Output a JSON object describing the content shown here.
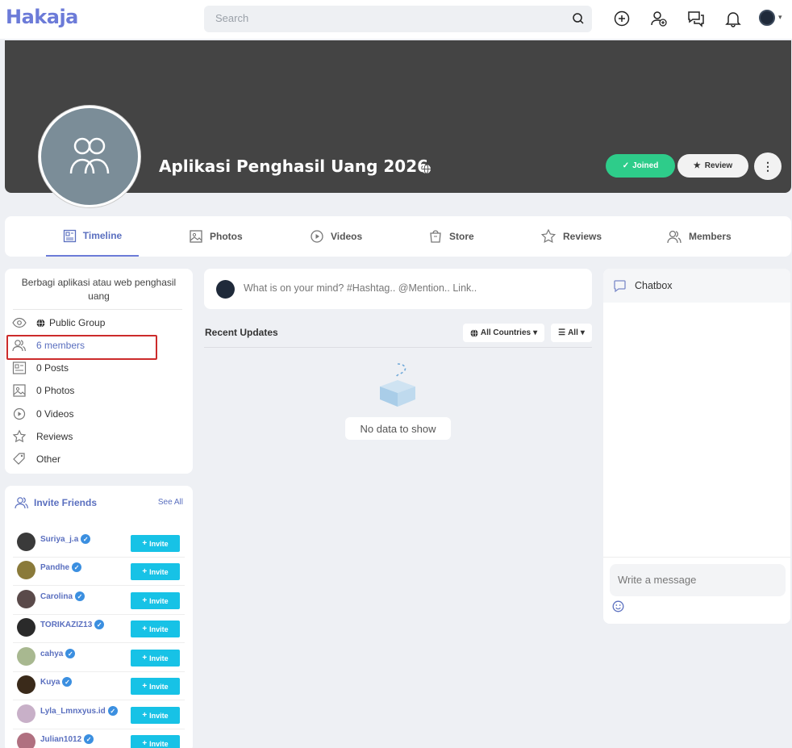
{
  "header": {
    "logo": "Hakaja",
    "search_placeholder": "Search"
  },
  "group": {
    "name": "Aplikasi Penghasil Uang 2026",
    "joined_label": "Joined",
    "review_label": "Review"
  },
  "tabs": [
    {
      "label": "Timeline",
      "icon": "timeline-icon",
      "active": true
    },
    {
      "label": "Photos",
      "icon": "photos-icon"
    },
    {
      "label": "Videos",
      "icon": "videos-icon"
    },
    {
      "label": "Store",
      "icon": "store-icon"
    },
    {
      "label": "Reviews",
      "icon": "star-icon"
    },
    {
      "label": "Members",
      "icon": "members-icon"
    }
  ],
  "info": {
    "description": "Berbagi aplikasi atau web penghasil uang",
    "rows": [
      {
        "label": "Public Group",
        "icon": "eye-icon"
      },
      {
        "label": "6 members",
        "icon": "members-icon"
      },
      {
        "label": "0 Posts",
        "icon": "posts-icon"
      },
      {
        "label": "0 Photos",
        "icon": "photos-icon"
      },
      {
        "label": "0 Videos",
        "icon": "videos-icon"
      },
      {
        "label": "Reviews",
        "icon": "star-icon"
      },
      {
        "label": "Other",
        "icon": "tag-icon"
      }
    ]
  },
  "invite": {
    "title": "Invite Friends",
    "see_all": "See All",
    "button_label": "Invite",
    "friends": [
      {
        "name": "Suriya_j.a",
        "color": "#3a3a3a"
      },
      {
        "name": "Pandhe",
        "color": "#8a7a3a"
      },
      {
        "name": "Carolina",
        "color": "#5a4a4a"
      },
      {
        "name": "TORIKAZIZ13",
        "color": "#2a2a2a"
      },
      {
        "name": "cahya",
        "color": "#a8b890"
      },
      {
        "name": "Kuya",
        "color": "#3a2a1a"
      },
      {
        "name": "Lyla_Lmnxyus.id",
        "color": "#c8b0c8"
      },
      {
        "name": "Julian1012",
        "color": "#b07080"
      }
    ]
  },
  "feed": {
    "composer_placeholder": "What is on your mind? #Hashtag.. @Mention.. Link..",
    "recent_title": "Recent Updates",
    "filter_countries": "All Countries",
    "filter_all": "All",
    "empty_text": "No data to show"
  },
  "chatbox": {
    "title": "Chatbox",
    "input_placeholder": "Write a message"
  },
  "colors": {
    "accent": "#6c7bd8",
    "joined_green": "#2ecc8a",
    "invite_cyan": "#17c2e6",
    "highlight_red": "#cc2b2b"
  }
}
